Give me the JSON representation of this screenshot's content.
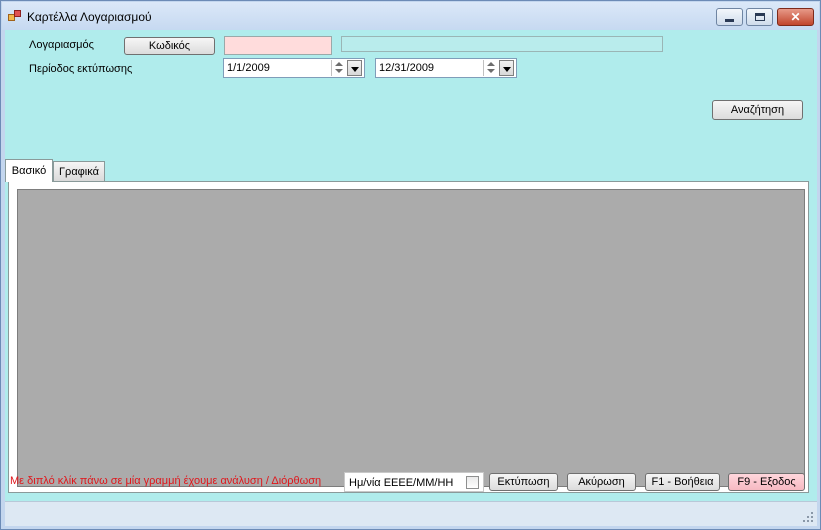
{
  "window": {
    "title": "Καρτέλλα Λογαριασμού",
    "controls": {
      "minimize": "minimize",
      "maximize": "maximize",
      "close": "✕"
    }
  },
  "filters": {
    "account_label": "Λογαριασμός",
    "code_button": "Κωδικός",
    "account_code_value": "",
    "account_name_value": "",
    "period_label": "Περίοδος εκτύπωσης",
    "date_from": "1/1/2009",
    "date_to": "12/31/2009",
    "search_button": "Αναζήτηση"
  },
  "tabs": [
    {
      "label": "Βασικό",
      "active": true
    },
    {
      "label": "Γραφικά",
      "active": false
    }
  ],
  "footer": {
    "hint": "Με διπλό κλίκ πάνω σε μία γραμμή έχουμε ανάλυση / Διόρθωση",
    "date_format_value": "Ημ/νία ΕΕΕΕ/ΜΜ/ΗΗ",
    "print_button": "Εκτύπωση",
    "cancel_button": "Ακύρωση",
    "help_button": "F1 - Βοήθεια",
    "exit_button": "F9 - Εξοδος"
  },
  "colors": {
    "client_bg": "#b0ecec",
    "hint_text": "#e0161b",
    "code_field_bg": "#ffdcdc",
    "exit_button_bg": "#f6b9c2"
  }
}
